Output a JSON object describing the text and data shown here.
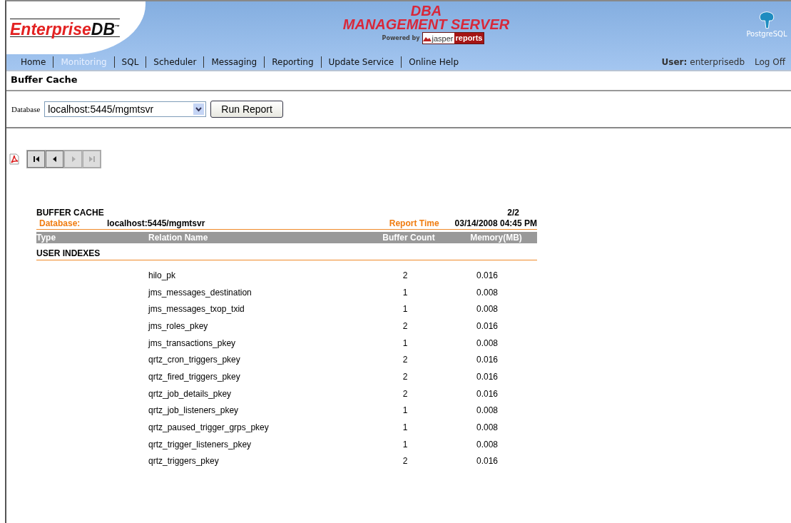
{
  "header": {
    "logo_text": "Enterprise",
    "logo_text_2": "DB",
    "logo_mark": "™",
    "title_line_1": "DBA",
    "title_line_2": "MANAGEMENT SERVER",
    "powered_by": "Powered by",
    "jasper_1": "jasper",
    "jasper_2": "reports",
    "postgres_label": "PostgreSQL"
  },
  "nav": {
    "tabs": [
      {
        "label": "Home",
        "selected": false
      },
      {
        "label": "Monitoring",
        "selected": true
      },
      {
        "label": "SQL",
        "selected": false
      },
      {
        "label": "Scheduler",
        "selected": false
      },
      {
        "label": "Messaging",
        "selected": false
      },
      {
        "label": "Reporting",
        "selected": false
      },
      {
        "label": "Update Service",
        "selected": false
      },
      {
        "label": "Online Help",
        "selected": false
      }
    ],
    "user_label": "User:",
    "user_name": "enterprisedb",
    "logoff": "Log Off"
  },
  "page_title": "Buffer Cache",
  "form": {
    "database_label": "Database",
    "database_value": "localhost:5445/mgmtsvr",
    "run_button": "Run Report"
  },
  "pager": [
    {
      "kind": "first",
      "disabled": false
    },
    {
      "kind": "prev",
      "disabled": false
    },
    {
      "kind": "next",
      "disabled": true
    },
    {
      "kind": "last",
      "disabled": true
    }
  ],
  "report": {
    "title": "BUFFER CACHE",
    "page": "2/2",
    "database_label": "Database:",
    "database_value": "localhost:5445/mgmtsvr",
    "time_label": "Report Time",
    "time_value": "03/14/2008 04:45 PM",
    "columns": [
      "Type",
      "Relation Name",
      "Buffer Count",
      "Memory(MB)"
    ],
    "group": "USER INDEXES",
    "rows": [
      {
        "name": "hilo_pk",
        "count": "2",
        "memory": "0.016"
      },
      {
        "name": "jms_messages_destination",
        "count": "1",
        "memory": "0.008"
      },
      {
        "name": "jms_messages_txop_txid",
        "count": "1",
        "memory": "0.008"
      },
      {
        "name": "jms_roles_pkey",
        "count": "2",
        "memory": "0.016"
      },
      {
        "name": "jms_transactions_pkey",
        "count": "1",
        "memory": "0.008"
      },
      {
        "name": "qrtz_cron_triggers_pkey",
        "count": "2",
        "memory": "0.016"
      },
      {
        "name": "qrtz_fired_triggers_pkey",
        "count": "2",
        "memory": "0.016"
      },
      {
        "name": "qrtz_job_details_pkey",
        "count": "2",
        "memory": "0.016"
      },
      {
        "name": "qrtz_job_listeners_pkey",
        "count": "1",
        "memory": "0.008"
      },
      {
        "name": "qrtz_paused_trigger_grps_pkey",
        "count": "1",
        "memory": "0.008"
      },
      {
        "name": "qrtz_trigger_listeners_pkey",
        "count": "1",
        "memory": "0.008"
      },
      {
        "name": "qrtz_triggers_pkey",
        "count": "2",
        "memory": "0.016"
      }
    ]
  }
}
